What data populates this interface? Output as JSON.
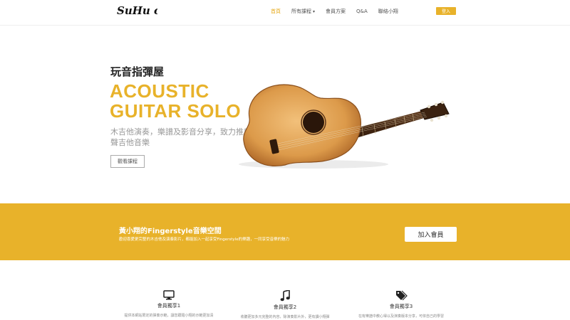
{
  "brand": {
    "logo_text": "SuHu club"
  },
  "nav": {
    "items": [
      {
        "label": "首頁",
        "active": true
      },
      {
        "label": "所有課程",
        "dropdown": true
      },
      {
        "label": "會員方案"
      },
      {
        "label": "Q&A"
      },
      {
        "label": "聯絡小翔"
      }
    ],
    "join_label": "登入"
  },
  "hero": {
    "subtitle": "玩音指彈屋",
    "title_line1": "ACOUSTIC",
    "title_line2": "GUITAR SOLO",
    "description": "木吉他演奏，樂譜及影音分享，致力推廣原聲吉他音樂",
    "button_label": "觀看課程"
  },
  "band": {
    "title": "黃小翔的Fingerstyle音樂空間",
    "text": "歡迎喜愛更完整的木吉他及演奏影片，都能加入一起享受Fingerstyle的樂趣，一同享受音樂的魅力",
    "button_label": "加入會員"
  },
  "features": [
    {
      "icon": "monitor-icon",
      "title": "會員獨享1",
      "text": "提供本網站限定的彈奏示範，讓您跟隨小翔的示範更加清"
    },
    {
      "icon": "music-note-icon",
      "title": "會員獨享2",
      "text": "收聽更加多元完整的內容，除演奏影片外，更有讀小翔彈"
    },
    {
      "icon": "tags-icon",
      "title": "會員獨享3",
      "text": "在有樂譜中教心得以及演奏版本分享，可依自己的學習"
    }
  ],
  "colors": {
    "accent": "#e8b22a",
    "text_dark": "#222222",
    "text_muted": "#999999"
  }
}
